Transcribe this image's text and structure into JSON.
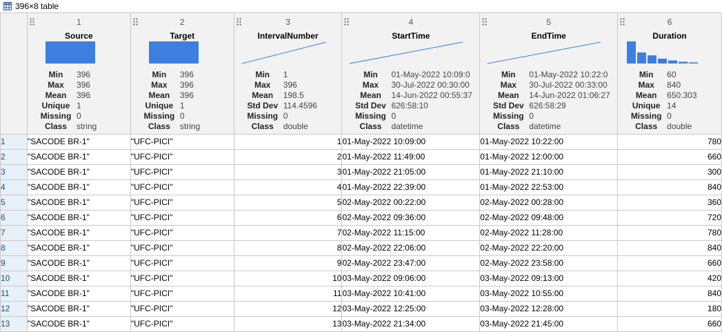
{
  "window": {
    "title": "396×8 table"
  },
  "colors": {
    "accent": "#3c7fe0",
    "row_header_bg": "#e8f0f8",
    "header_bg": "#f2f2f2"
  },
  "columns": [
    {
      "index": "1",
      "name": "Source",
      "stats": [
        {
          "k": "Min",
          "v": "396"
        },
        {
          "k": "Max",
          "v": "396"
        },
        {
          "k": "Mean",
          "v": "396"
        },
        {
          "k": "Unique",
          "v": "1"
        },
        {
          "k": "Missing",
          "v": "0"
        },
        {
          "k": "Class",
          "v": "string"
        }
      ]
    },
    {
      "index": "2",
      "name": "Target",
      "stats": [
        {
          "k": "Min",
          "v": "396"
        },
        {
          "k": "Max",
          "v": "396"
        },
        {
          "k": "Mean",
          "v": "396"
        },
        {
          "k": "Unique",
          "v": "1"
        },
        {
          "k": "Missing",
          "v": "0"
        },
        {
          "k": "Class",
          "v": "string"
        }
      ]
    },
    {
      "index": "3",
      "name": "IntervalNumber",
      "stats": [
        {
          "k": "Min",
          "v": "1"
        },
        {
          "k": "Max",
          "v": "396"
        },
        {
          "k": "Mean",
          "v": "198.5"
        },
        {
          "k": "Std Dev",
          "v": "114.4596"
        },
        {
          "k": "Missing",
          "v": "0"
        },
        {
          "k": "Class",
          "v": "double"
        }
      ]
    },
    {
      "index": "4",
      "name": "StartTime",
      "stats": [
        {
          "k": "Min",
          "v": "01-May-2022 10:09:0"
        },
        {
          "k": "Max",
          "v": "30-Jul-2022 00:30:00"
        },
        {
          "k": "Mean",
          "v": "14-Jun-2022 00:55:37"
        },
        {
          "k": "Std Dev",
          "v": "626:58:10"
        },
        {
          "k": "Missing",
          "v": "0"
        },
        {
          "k": "Class",
          "v": "datetime"
        }
      ]
    },
    {
      "index": "5",
      "name": "EndTime",
      "stats": [
        {
          "k": "Min",
          "v": "01-May-2022 10:22:0"
        },
        {
          "k": "Max",
          "v": "30-Jul-2022 00:33:00"
        },
        {
          "k": "Mean",
          "v": "14-Jun-2022 01:06:27"
        },
        {
          "k": "Std Dev",
          "v": "626:58:29"
        },
        {
          "k": "Missing",
          "v": "0"
        },
        {
          "k": "Class",
          "v": "datetime"
        }
      ]
    },
    {
      "index": "6",
      "name": "Duration",
      "stats": [
        {
          "k": "Min",
          "v": "60"
        },
        {
          "k": "Max",
          "v": "840"
        },
        {
          "k": "Mean",
          "v": "650.303"
        },
        {
          "k": "Unique",
          "v": "14"
        },
        {
          "k": "Missing",
          "v": "0"
        },
        {
          "k": "Class",
          "v": "double"
        }
      ]
    }
  ],
  "duration_histogram": [
    1.0,
    0.5,
    0.37,
    0.22,
    0.14,
    0.08,
    0.05
  ],
  "rows": [
    {
      "n": "1",
      "source": "\"SACODE BR-1\"",
      "target": "\"UFC-PICI\"",
      "interval": "1",
      "start": "01-May-2022 10:09:00",
      "end": "01-May-2022 10:22:00",
      "duration": "780"
    },
    {
      "n": "2",
      "source": "\"SACODE BR-1\"",
      "target": "\"UFC-PICI\"",
      "interval": "2",
      "start": "01-May-2022 11:49:00",
      "end": "01-May-2022 12:00:00",
      "duration": "660"
    },
    {
      "n": "3",
      "source": "\"SACODE BR-1\"",
      "target": "\"UFC-PICI\"",
      "interval": "3",
      "start": "01-May-2022 21:05:00",
      "end": "01-May-2022 21:10:00",
      "duration": "300"
    },
    {
      "n": "4",
      "source": "\"SACODE BR-1\"",
      "target": "\"UFC-PICI\"",
      "interval": "4",
      "start": "01-May-2022 22:39:00",
      "end": "01-May-2022 22:53:00",
      "duration": "840"
    },
    {
      "n": "5",
      "source": "\"SACODE BR-1\"",
      "target": "\"UFC-PICI\"",
      "interval": "5",
      "start": "02-May-2022 00:22:00",
      "end": "02-May-2022 00:28:00",
      "duration": "360"
    },
    {
      "n": "6",
      "source": "\"SACODE BR-1\"",
      "target": "\"UFC-PICI\"",
      "interval": "6",
      "start": "02-May-2022 09:36:00",
      "end": "02-May-2022 09:48:00",
      "duration": "720"
    },
    {
      "n": "7",
      "source": "\"SACODE BR-1\"",
      "target": "\"UFC-PICI\"",
      "interval": "7",
      "start": "02-May-2022 11:15:00",
      "end": "02-May-2022 11:28:00",
      "duration": "780"
    },
    {
      "n": "8",
      "source": "\"SACODE BR-1\"",
      "target": "\"UFC-PICI\"",
      "interval": "8",
      "start": "02-May-2022 22:06:00",
      "end": "02-May-2022 22:20:00",
      "duration": "840"
    },
    {
      "n": "9",
      "source": "\"SACODE BR-1\"",
      "target": "\"UFC-PICI\"",
      "interval": "9",
      "start": "02-May-2022 23:47:00",
      "end": "02-May-2022 23:58:00",
      "duration": "660"
    },
    {
      "n": "10",
      "source": "\"SACODE BR-1\"",
      "target": "\"UFC-PICI\"",
      "interval": "10",
      "start": "03-May-2022 09:06:00",
      "end": "03-May-2022 09:13:00",
      "duration": "420"
    },
    {
      "n": "11",
      "source": "\"SACODE BR-1\"",
      "target": "\"UFC-PICI\"",
      "interval": "11",
      "start": "03-May-2022 10:41:00",
      "end": "03-May-2022 10:55:00",
      "duration": "840"
    },
    {
      "n": "12",
      "source": "\"SACODE BR-1\"",
      "target": "\"UFC-PICI\"",
      "interval": "12",
      "start": "03-May-2022 12:25:00",
      "end": "03-May-2022 12:28:00",
      "duration": "180"
    },
    {
      "n": "13",
      "source": "\"SACODE BR-1\"",
      "target": "\"UFC-PICI\"",
      "interval": "13",
      "start": "03-May-2022 21:34:00",
      "end": "03-May-2022 21:45:00",
      "duration": "660"
    }
  ]
}
